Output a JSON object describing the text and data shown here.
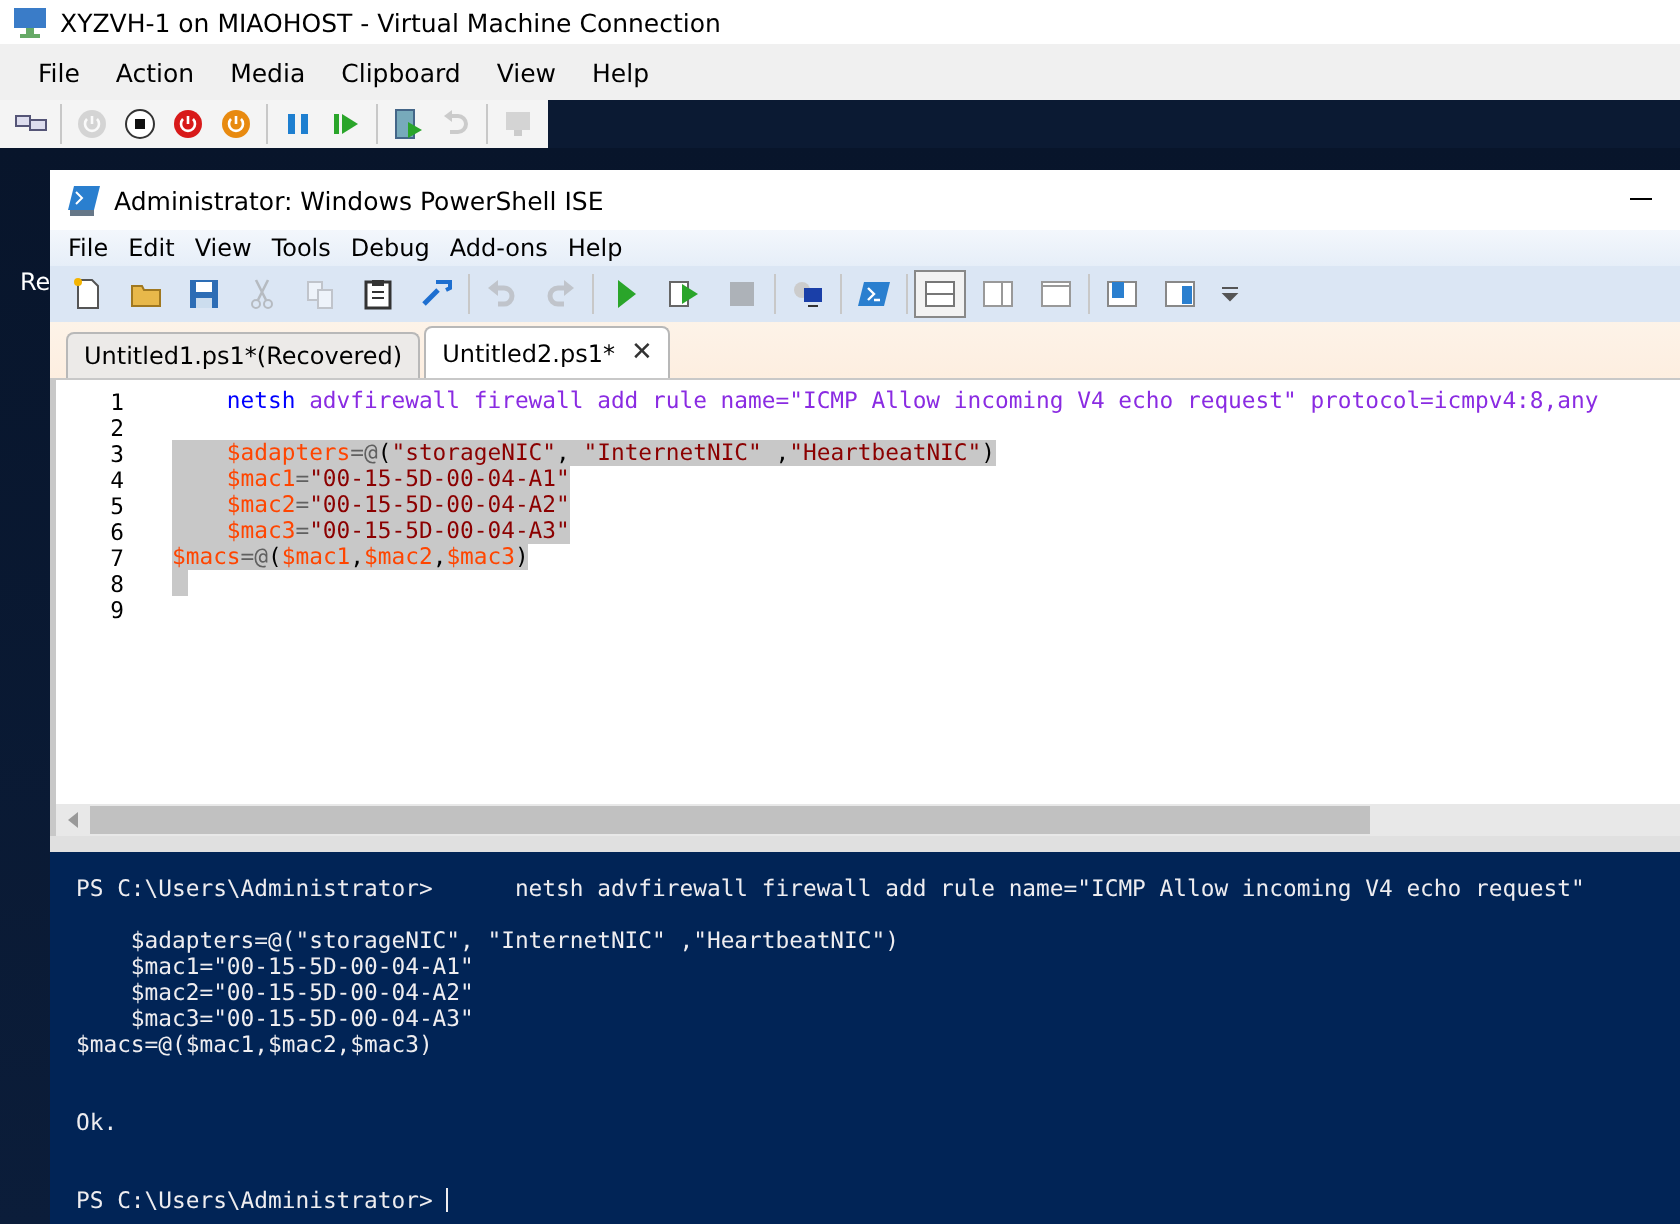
{
  "vm_window": {
    "title": "XYZVH-1 on MIAOHOST - Virtual Machine Connection",
    "menu": [
      "File",
      "Action",
      "Media",
      "Clipboard",
      "View",
      "Help"
    ],
    "toolbar": [
      {
        "disabled": false
      },
      {
        "disabled": true
      },
      {
        "disabled": false
      },
      {
        "disabled": false
      },
      {
        "disabled": false
      },
      {
        "disabled": false
      },
      {
        "disabled": false
      },
      {
        "disabled": false
      },
      {
        "disabled": true
      },
      {
        "disabled": true
      }
    ]
  },
  "desktop": {
    "label": "Re"
  },
  "ise_window": {
    "title": "Administrator: Windows PowerShell ISE",
    "menu": [
      "File",
      "Edit",
      "View",
      "Tools",
      "Debug",
      "Add-ons",
      "Help"
    ],
    "toolbar": [
      {
        "disabled": false,
        "selected": false
      },
      {
        "disabled": false,
        "selected": false
      },
      {
        "disabled": false,
        "selected": false
      },
      {
        "disabled": true,
        "selected": false
      },
      {
        "disabled": true,
        "selected": false
      },
      {
        "disabled": false,
        "selected": false
      },
      {
        "disabled": false,
        "selected": false
      },
      {
        "disabled": true,
        "selected": false
      },
      {
        "disabled": true,
        "selected": false
      },
      {
        "disabled": false,
        "selected": false
      },
      {
        "disabled": false,
        "selected": false
      },
      {
        "disabled": true,
        "selected": false
      },
      {
        "disabled": false,
        "selected": false
      },
      {
        "disabled": false,
        "selected": false
      },
      {
        "disabled": false,
        "selected": true
      },
      {
        "disabled": false,
        "selected": false
      },
      {
        "disabled": false,
        "selected": false
      },
      {
        "disabled": false,
        "selected": false
      },
      {
        "disabled": false,
        "selected": false
      },
      {
        "disabled": false,
        "selected": false
      }
    ],
    "tabs": [
      {
        "label": "Untitled1.ps1*(Recovered)",
        "selected": false
      },
      {
        "label": "Untitled2.ps1*",
        "selected": true,
        "close": "✕"
      }
    ],
    "editor_lines": [
      {
        "number": "1",
        "selected": false,
        "indent": true,
        "tokens": [
          {
            "kind": "command",
            "text": "netsh"
          },
          {
            "kind": "argument",
            "text": " advfirewall firewall add rule name=\"ICMP Allow incoming V4 echo request\" protocol=icmpv4:8,any"
          }
        ]
      },
      {
        "number": "2",
        "selected": false
      },
      {
        "number": "3",
        "selected": true,
        "indent": true,
        "tokens": [
          {
            "kind": "variable",
            "text": "$adapters"
          },
          {
            "kind": "operator",
            "text": "=@"
          },
          {
            "kind": "plain",
            "text": "("
          },
          {
            "kind": "string",
            "text": "\"storageNIC\""
          },
          {
            "kind": "plain",
            "text": ", "
          },
          {
            "kind": "string",
            "text": "\"InternetNIC\""
          },
          {
            "kind": "plain",
            "text": " ,"
          },
          {
            "kind": "string",
            "text": "\"HeartbeatNIC\""
          },
          {
            "kind": "plain",
            "text": ")"
          }
        ]
      },
      {
        "number": "4",
        "selected": true,
        "indent": true,
        "tokens": [
          {
            "kind": "variable",
            "text": "$mac1"
          },
          {
            "kind": "operator",
            "text": "="
          },
          {
            "kind": "string",
            "text": "\"00-15-5D-00-04-A1\""
          }
        ]
      },
      {
        "number": "5",
        "selected": true,
        "indent": true,
        "tokens": [
          {
            "kind": "variable",
            "text": "$mac2"
          },
          {
            "kind": "operator",
            "text": "="
          },
          {
            "kind": "string",
            "text": "\"00-15-5D-00-04-A2\""
          }
        ]
      },
      {
        "number": "6",
        "selected": true,
        "indent": true,
        "tokens": [
          {
            "kind": "variable",
            "text": "$mac3"
          },
          {
            "kind": "operator",
            "text": "="
          },
          {
            "kind": "string",
            "text": "\"00-15-5D-00-04-A3\""
          }
        ]
      },
      {
        "number": "7",
        "selected": true,
        "indent": false,
        "tokens": [
          {
            "kind": "variable",
            "text": "$macs"
          },
          {
            "kind": "operator",
            "text": "=@"
          },
          {
            "kind": "plain",
            "text": "("
          },
          {
            "kind": "variable",
            "text": "$mac1"
          },
          {
            "kind": "plain",
            "text": ","
          },
          {
            "kind": "variable",
            "text": "$mac2"
          },
          {
            "kind": "plain",
            "text": ","
          },
          {
            "kind": "variable",
            "text": "$mac3"
          },
          {
            "kind": "plain",
            "text": ")"
          }
        ]
      },
      {
        "number": "8",
        "selected": true
      },
      {
        "number": "9",
        "selected": false
      }
    ],
    "console_lines": [
      {
        "kind": "output",
        "text": "PS C:\\Users\\Administrator>      netsh advfirewall firewall add rule name=\"ICMP Allow incoming V4 echo request\""
      },
      {
        "kind": "blank"
      },
      {
        "kind": "output",
        "text": "    $adapters=@(\"storageNIC\", \"InternetNIC\" ,\"HeartbeatNIC\")"
      },
      {
        "kind": "output",
        "text": "    $mac1=\"00-15-5D-00-04-A1\""
      },
      {
        "kind": "output",
        "text": "    $mac2=\"00-15-5D-00-04-A2\""
      },
      {
        "kind": "output",
        "text": "    $mac3=\"00-15-5D-00-04-A3\""
      },
      {
        "kind": "output",
        "text": "$macs=@($mac1,$mac2,$mac3)"
      },
      {
        "kind": "blank"
      },
      {
        "kind": "blank"
      },
      {
        "kind": "output",
        "text": "Ok."
      },
      {
        "kind": "blank"
      },
      {
        "kind": "blank"
      },
      {
        "kind": "input",
        "text": "PS C:\\Users\\Administrator> "
      }
    ]
  }
}
